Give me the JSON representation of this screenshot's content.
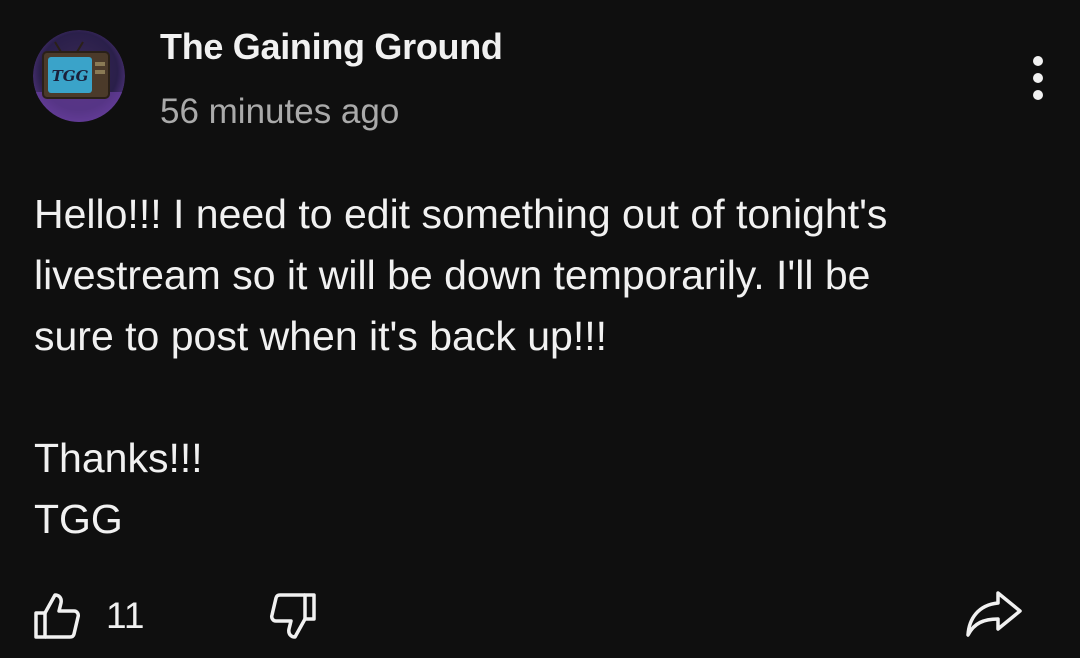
{
  "post": {
    "channel_name": "The Gaining Ground",
    "timestamp": "56 minutes ago",
    "avatar_text": "TGG",
    "body_lines": [
      "Hello!!! I need to edit something out of tonight's",
      "livestream so it will be down temporarily. I'll be",
      "sure to post when it's back up!!!",
      "Thanks!!!",
      "TGG"
    ],
    "likes": "11"
  },
  "icons": {
    "menu": "more-vert-icon",
    "like": "thumbs-up-icon",
    "dislike": "thumbs-down-icon",
    "share": "share-arrow-icon"
  },
  "colors": {
    "background": "#0f0f0f",
    "text": "#f1f1f1",
    "secondary_text": "#aaaaaa"
  }
}
